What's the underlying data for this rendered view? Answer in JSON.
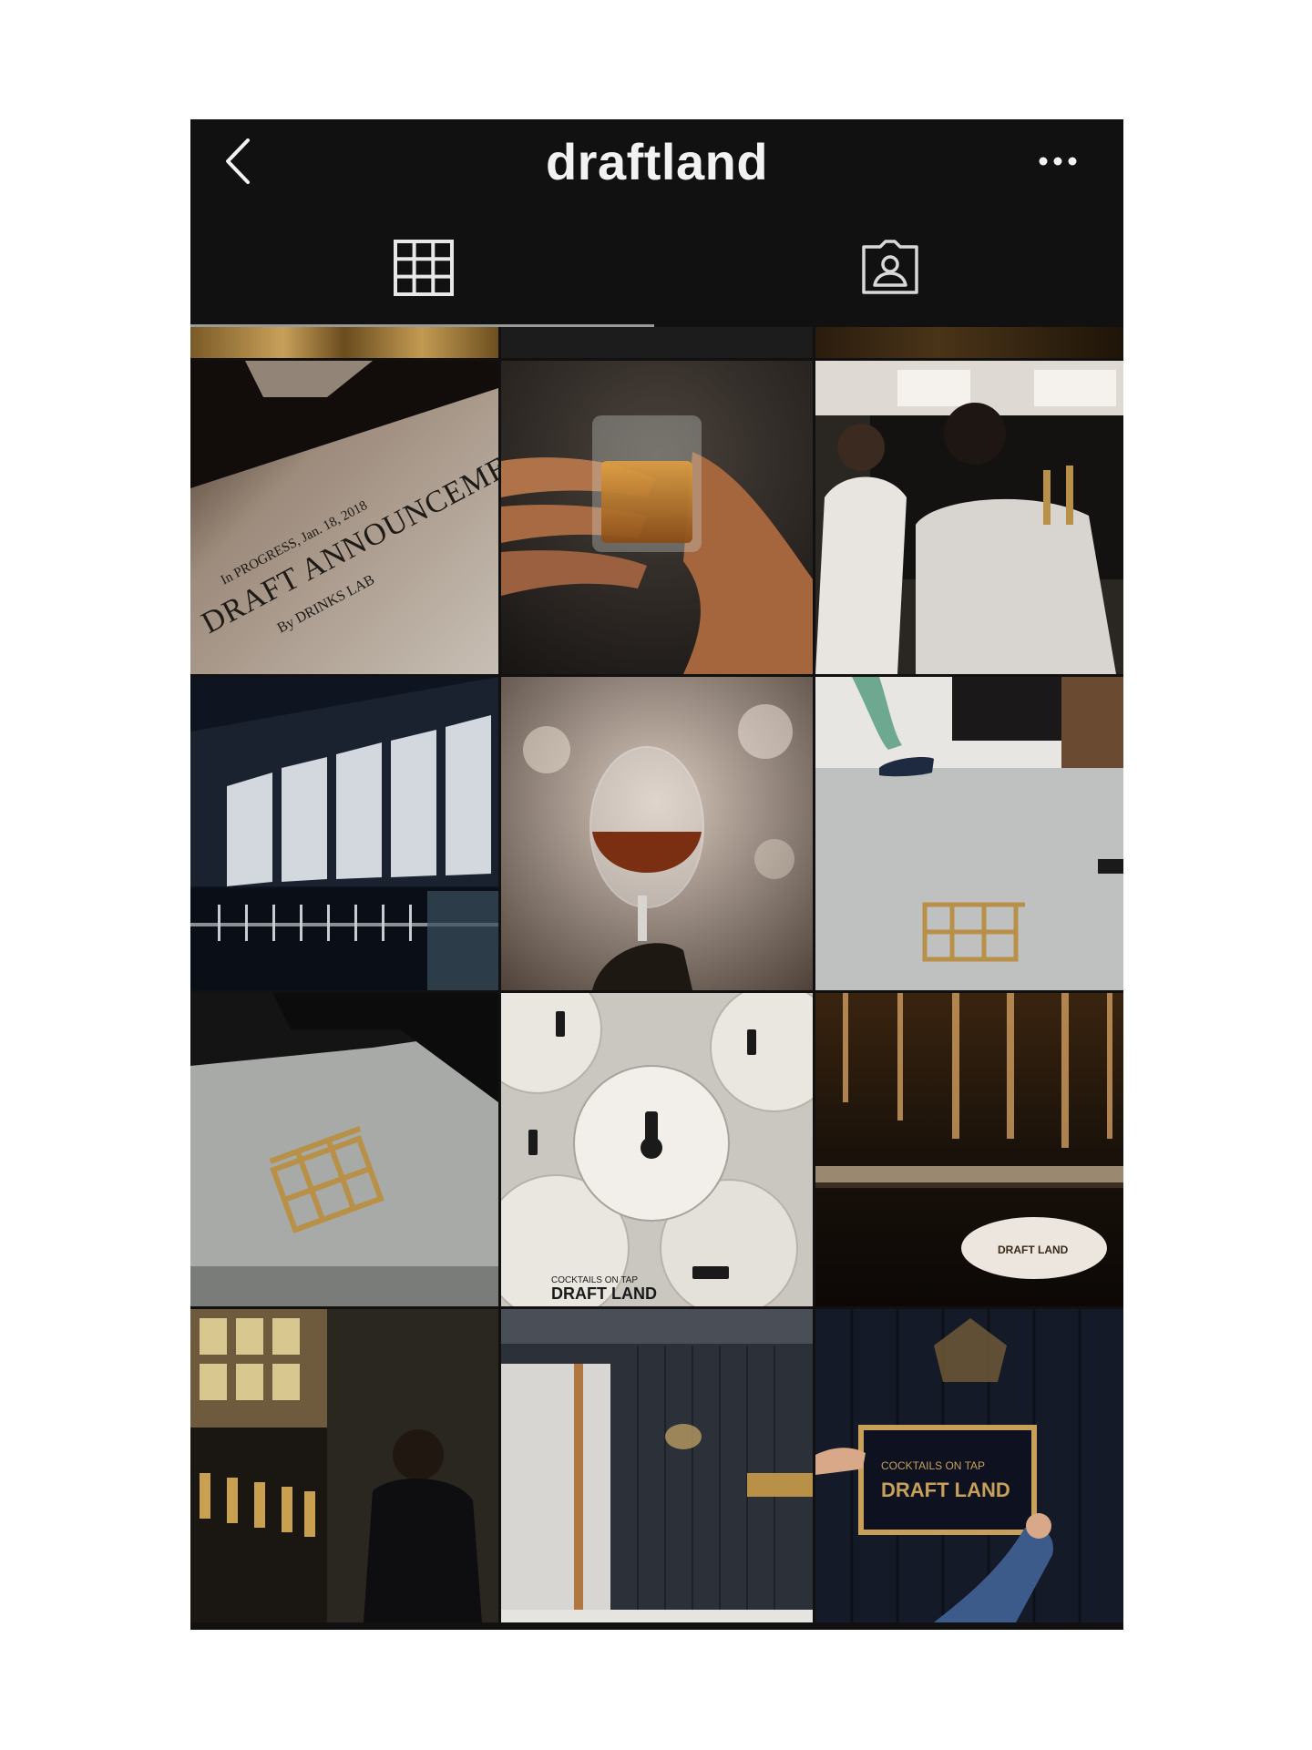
{
  "header": {
    "title": "draftland",
    "back_icon": "chevron-left-icon",
    "more_icon": "more-horizontal-icon"
  },
  "tabs": [
    {
      "name": "grid",
      "icon": "grid-icon",
      "active": true
    },
    {
      "name": "tagged",
      "icon": "tagged-person-icon",
      "active": false
    }
  ],
  "posts": {
    "announcement": {
      "text_date": "In PROGRESS, Jan. 18, 2018",
      "text_main": "DRAFT ANNOUNCEMEN",
      "text_by": "By DRINKS LAB"
    },
    "coasters": {
      "text_coaster_small": "COCKTAILS ON TAP",
      "text_coaster_big": "DRAFT LAND"
    },
    "taps_shelf": {
      "coaster_text": "DRAFT LAND"
    },
    "sign": {
      "sign_small": "COCKTAILS ON TAP",
      "sign_big": "DRAFT LAND"
    }
  },
  "colors": {
    "background": "#ffffff",
    "app_bg": "#111111",
    "header_text": "#f2f2f2",
    "indicator": "#9a9a9a",
    "brass": "#b89048"
  }
}
